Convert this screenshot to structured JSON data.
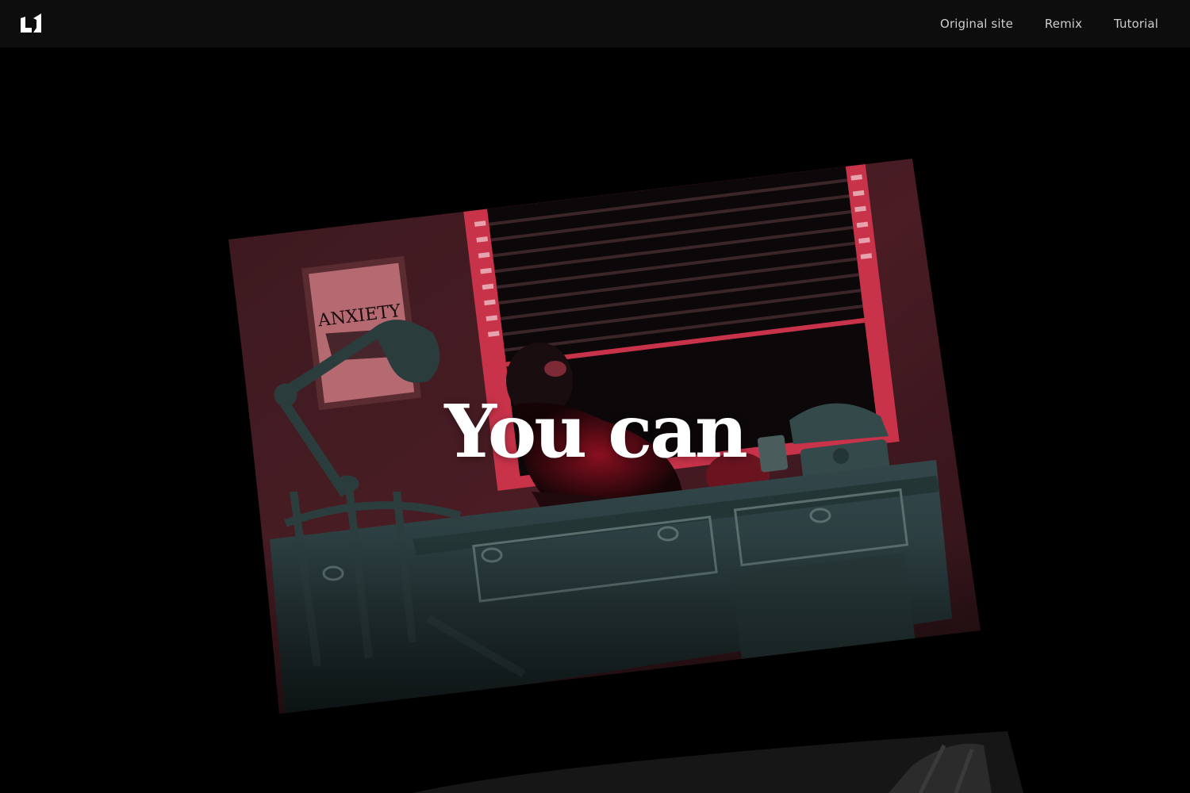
{
  "header": {
    "logo": "logo-mark",
    "nav": [
      {
        "label": "Original site"
      },
      {
        "label": "Remix"
      },
      {
        "label": "Tutorial"
      }
    ]
  },
  "hero": {
    "headline": "You can",
    "image": {
      "poster_text": "ANXIETY"
    }
  },
  "colors": {
    "background": "#000000",
    "topbar": "#0d0d0d",
    "nav_text": "#cfcfcf",
    "headline": "#ffffff",
    "accent_red": "#c8334a",
    "desk_teal": "#2c3e3d"
  }
}
